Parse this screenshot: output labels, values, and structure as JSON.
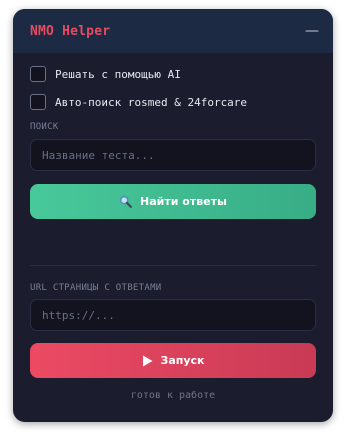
{
  "header": {
    "title": "NMO Helper",
    "minimize_symbol": "—"
  },
  "options": [
    {
      "label": "Решать с помощью AI",
      "checked": false
    },
    {
      "label": "Авто-поиск rosmed & 24forcare",
      "checked": false
    }
  ],
  "search": {
    "section_label": "ПОИСК",
    "placeholder": "Название теста...",
    "value": "",
    "button_label": "Найти ответы",
    "button_icon": "magnifier-icon"
  },
  "url": {
    "section_label": "URL СТРАНИЦЫ С ОТВЕТАМИ",
    "placeholder": "https://...",
    "value": "",
    "button_label": "Запуск",
    "button_icon": "play-icon"
  },
  "status": "готов к работе",
  "colors": {
    "title": "#e84a5f",
    "header_bg": "#1d2a44",
    "panel_bg": "#1b1d2e",
    "find_button": "#48c99a",
    "run_button": "#ec4a63"
  }
}
